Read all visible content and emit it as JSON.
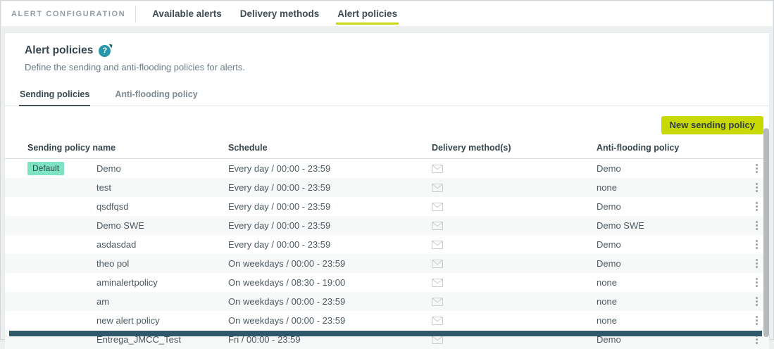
{
  "header": {
    "app_label": "ALERT CONFIGURATION",
    "tabs": [
      {
        "label": "Available alerts",
        "active": false
      },
      {
        "label": "Delivery methods",
        "active": false
      },
      {
        "label": "Alert policies",
        "active": true
      }
    ]
  },
  "page": {
    "title": "Alert policies",
    "help_glyph": "?",
    "subtitle": "Define the sending and anti-flooding policies for alerts.",
    "subtabs": [
      {
        "label": "Sending policies",
        "active": true
      },
      {
        "label": "Anti-flooding policy",
        "active": false
      }
    ],
    "new_policy_button": "New sending policy"
  },
  "table": {
    "columns": [
      "Sending policy name",
      "Schedule",
      "Delivery method(s)",
      "Anti-flooding policy"
    ],
    "rows": [
      {
        "badge": "Default",
        "name": "Demo",
        "schedule": "Every day / 00:00 - 23:59",
        "delivery_icon": "email-envelope-icon",
        "anti_flooding": "Demo"
      },
      {
        "badge": "",
        "name": "test",
        "schedule": "Every day / 00:00 - 23:59",
        "delivery_icon": "email-envelope-icon",
        "anti_flooding": "none"
      },
      {
        "badge": "",
        "name": "qsdfqsd",
        "schedule": "Every day / 00:00 - 23:59",
        "delivery_icon": "email-envelope-icon",
        "anti_flooding": "Demo"
      },
      {
        "badge": "",
        "name": "Demo SWE",
        "schedule": "Every day / 00:00 - 23:59",
        "delivery_icon": "email-envelope-icon",
        "anti_flooding": "Demo SWE"
      },
      {
        "badge": "",
        "name": "asdasdad",
        "schedule": "Every day / 00:00 - 23:59",
        "delivery_icon": "email-envelope-icon",
        "anti_flooding": "Demo"
      },
      {
        "badge": "",
        "name": "theo pol",
        "schedule": "On weekdays / 00:00 - 23:59",
        "delivery_icon": "email-envelope-icon",
        "anti_flooding": "Demo"
      },
      {
        "badge": "",
        "name": "aminalertpolicy",
        "schedule": "On weekdays / 08:30 - 19:00",
        "delivery_icon": "email-envelope-icon",
        "anti_flooding": "none"
      },
      {
        "badge": "",
        "name": "am",
        "schedule": "On weekdays / 00:00 - 23:59",
        "delivery_icon": "email-envelope-icon",
        "anti_flooding": "none"
      },
      {
        "badge": "",
        "name": "new alert policy",
        "schedule": "On weekdays / 00:00 - 23:59",
        "delivery_icon": "email-envelope-icon",
        "anti_flooding": "none"
      },
      {
        "badge": "",
        "name": "Entrega_JMCC_Test",
        "schedule": "Fri / 00:00 - 23:59",
        "delivery_icon": "email-envelope-icon",
        "anti_flooding": "Demo"
      }
    ]
  },
  "colors": {
    "accent_lime": "#c8d900",
    "badge_mint": "#7ee3c3",
    "help_teal": "#2797aa",
    "bottom_bar": "#30586b"
  }
}
